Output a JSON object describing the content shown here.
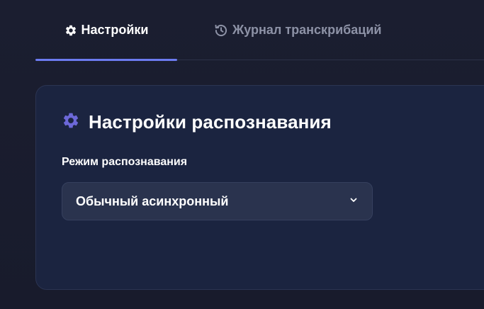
{
  "tabs": [
    {
      "label": "Настройки",
      "icon": "gear-icon",
      "active": true
    },
    {
      "label": "Журнал транскрибаций",
      "icon": "history-icon",
      "active": false
    }
  ],
  "settings_card": {
    "title": "Настройки распознавания",
    "icon": "gear-icon",
    "icon_color": "#6c68d8",
    "mode_label": "Режим распознавания",
    "mode_value": "Обычный асинхронный"
  },
  "colors": {
    "accent": "#6c7bf0",
    "background": "#1a1d2e",
    "card": "#1b2440",
    "select": "#2a334e"
  }
}
